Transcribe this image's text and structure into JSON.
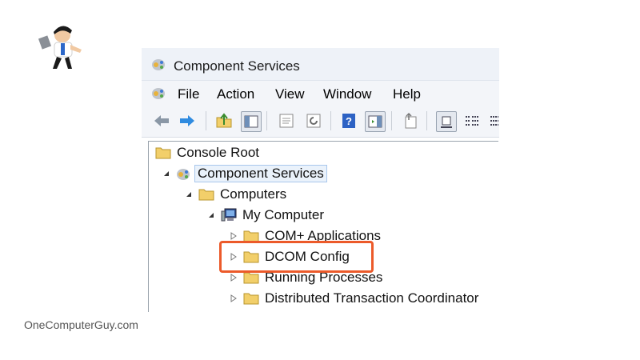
{
  "window": {
    "title": "Component Services"
  },
  "menu": [
    "File",
    "Action",
    "View",
    "Window",
    "Help"
  ],
  "toolbar": {
    "buttons": [
      "back-icon",
      "forward-icon",
      "up-folder-icon",
      "show-hide-tree-icon",
      "properties-icon",
      "refresh-icon",
      "help-icon",
      "action-pane-icon",
      "export-icon",
      "large-icons-view-icon",
      "list-view-icon",
      "details-view-icon"
    ]
  },
  "tree": {
    "console_root": "Console Root",
    "component_services": "Component Services",
    "computers": "Computers",
    "my_computer": "My Computer",
    "com_applications": "COM+ Applications",
    "dcom_config": "DCOM Config",
    "running_processes": "Running Processes",
    "dtc": "Distributed Transaction Coordinator"
  },
  "highlighted_item": "DCOM Config",
  "colors": {
    "highlight": "#ec5a2a",
    "folder": "#f2cf6a",
    "selection": "#eaf2fb"
  },
  "watermark": "OneComputerGuy.com"
}
